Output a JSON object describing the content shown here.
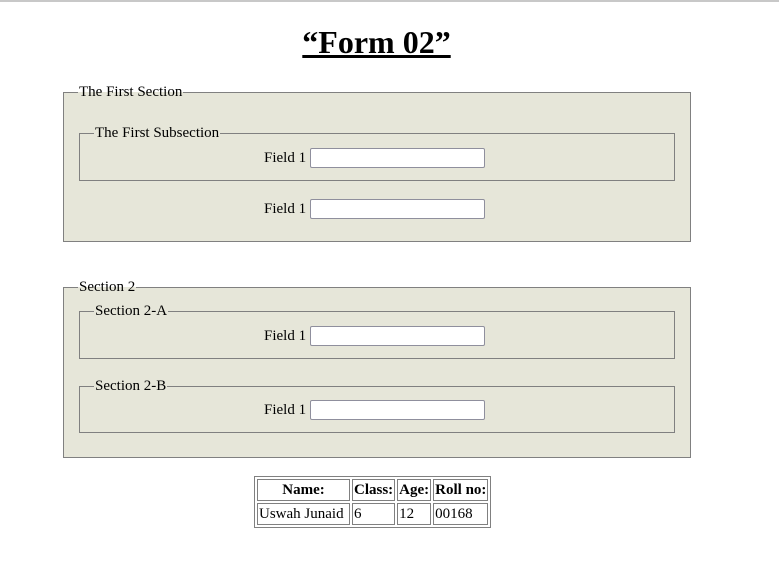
{
  "title": "“Form 02”",
  "section1": {
    "legend": "The First Section",
    "subsection": {
      "legend": "The First Subsection",
      "field_label": "Field 1",
      "field_value": ""
    },
    "field_label": "Field 1",
    "field_value": ""
  },
  "section2": {
    "legend": "Section 2",
    "sub_a": {
      "legend": "Section 2-A",
      "field_label": "Field 1",
      "field_value": ""
    },
    "sub_b": {
      "legend": "Section 2-B",
      "field_label": "Field 1",
      "field_value": ""
    }
  },
  "table": {
    "headers": [
      "Name:",
      "Class:",
      "Age:",
      "Roll no:"
    ],
    "rows": [
      [
        "Uswah Junaid",
        "6",
        "12",
        "00168"
      ]
    ]
  }
}
